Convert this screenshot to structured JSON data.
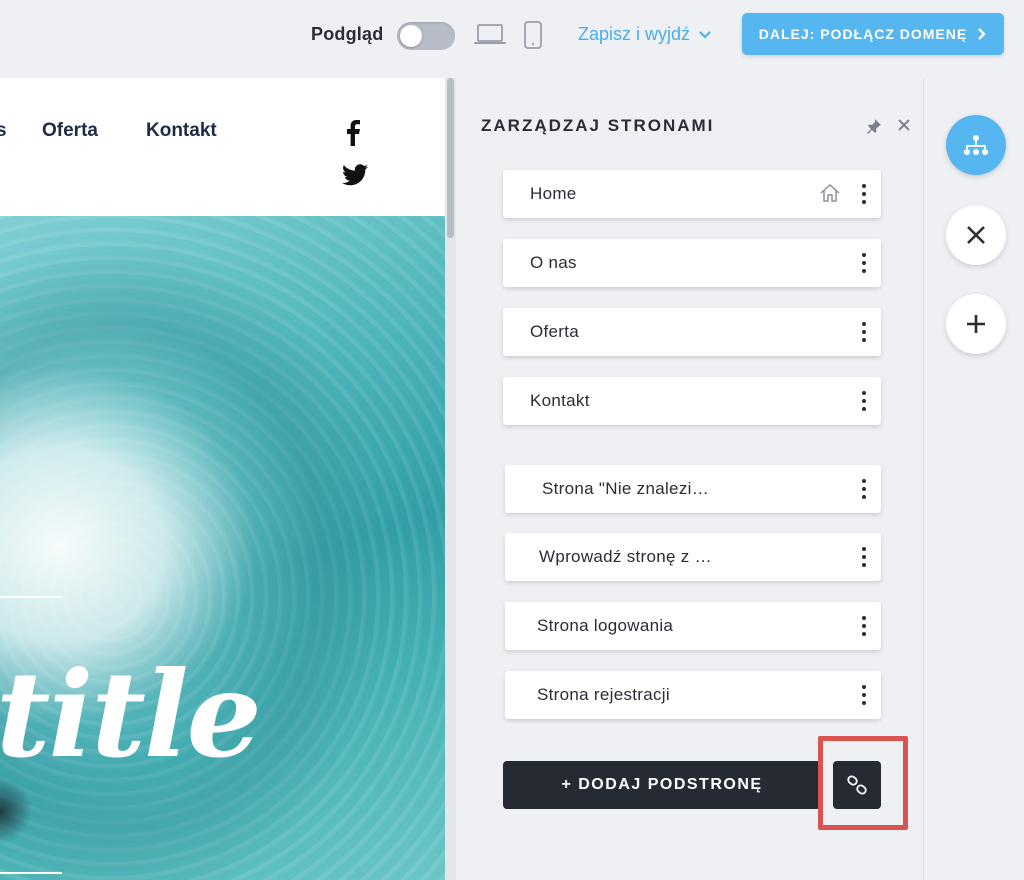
{
  "topbar": {
    "preview_label": "Podgląd",
    "save_exit_label": "Zapisz i wyjdź",
    "next_button_label": "DALEJ: PODŁĄCZ DOMENĘ",
    "accent_color": "#55b6f0"
  },
  "site": {
    "nav": [
      {
        "label": "s"
      },
      {
        "label": "Oferta"
      },
      {
        "label": "Kontakt"
      }
    ],
    "social_icons": [
      "facebook-icon",
      "twitter-icon"
    ],
    "hero_title": "title"
  },
  "panel": {
    "title": "ZARZĄDZAJ STRONAMI",
    "pages": [
      {
        "label": "Home",
        "is_home": true
      },
      {
        "label": "O nas"
      },
      {
        "label": "Oferta"
      },
      {
        "label": "Kontakt"
      }
    ],
    "special_pages": [
      {
        "label": "Strona \"Nie znalezi…"
      },
      {
        "label": "Wprowadź stronę z …"
      },
      {
        "label": "Strona logowania"
      },
      {
        "label": "Strona rejestracji"
      }
    ],
    "add_button_label": "+ DODAJ PODSTRONĘ",
    "highlight_color": "#d9534f"
  },
  "rail": {
    "buttons": [
      "sitemap-icon",
      "close-icon",
      "plus-icon"
    ]
  }
}
